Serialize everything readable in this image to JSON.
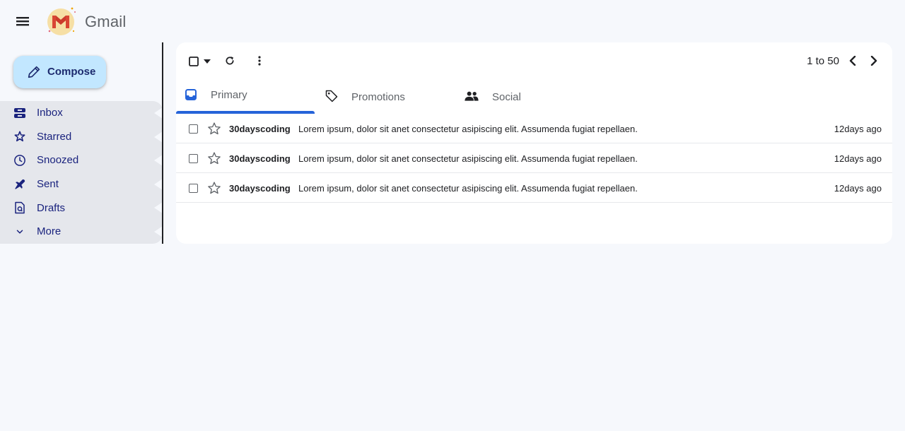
{
  "app": {
    "name": "Gmail",
    "accent": "#2563d9"
  },
  "header": {
    "menu_icon": "hamburger-menu-icon",
    "logo_icon": "gmail-logo-icon",
    "brand": "Gmail"
  },
  "sidebar": {
    "compose_label": "Compose",
    "compose_icon": "pencil-icon",
    "items": [
      {
        "label": "Inbox",
        "icon": "inbox-icon"
      },
      {
        "label": "Starred",
        "icon": "star-icon"
      },
      {
        "label": "Snoozed",
        "icon": "clock-icon"
      },
      {
        "label": "Sent",
        "icon": "send-icon"
      },
      {
        "label": "Drafts",
        "icon": "draft-icon"
      },
      {
        "label": "More",
        "icon": "chevron-down-icon"
      }
    ]
  },
  "toolbar": {
    "pagination": "1 to 50"
  },
  "tabs": [
    {
      "label": "Primary",
      "icon": "inbox-tray-icon",
      "selected": true
    },
    {
      "label": "Promotions",
      "icon": "tag-icon",
      "selected": false
    },
    {
      "label": "Social",
      "icon": "people-icon",
      "selected": false
    }
  ],
  "emails": [
    {
      "sender": "30dayscoding",
      "snippet": "Lorem ipsum, dolor sit anet consectetur asipiscing elit. Assumenda fugiat repellaen.",
      "time": "12days ago"
    },
    {
      "sender": "30dayscoding",
      "snippet": "Lorem ipsum, dolor sit anet consectetur asipiscing elit. Assumenda fugiat repellaen.",
      "time": "12days ago"
    },
    {
      "sender": "30dayscoding",
      "snippet": "Lorem ipsum, dolor sit anet consectetur asipiscing elit. Assumenda fugiat repellaen.",
      "time": "12days ago"
    }
  ]
}
